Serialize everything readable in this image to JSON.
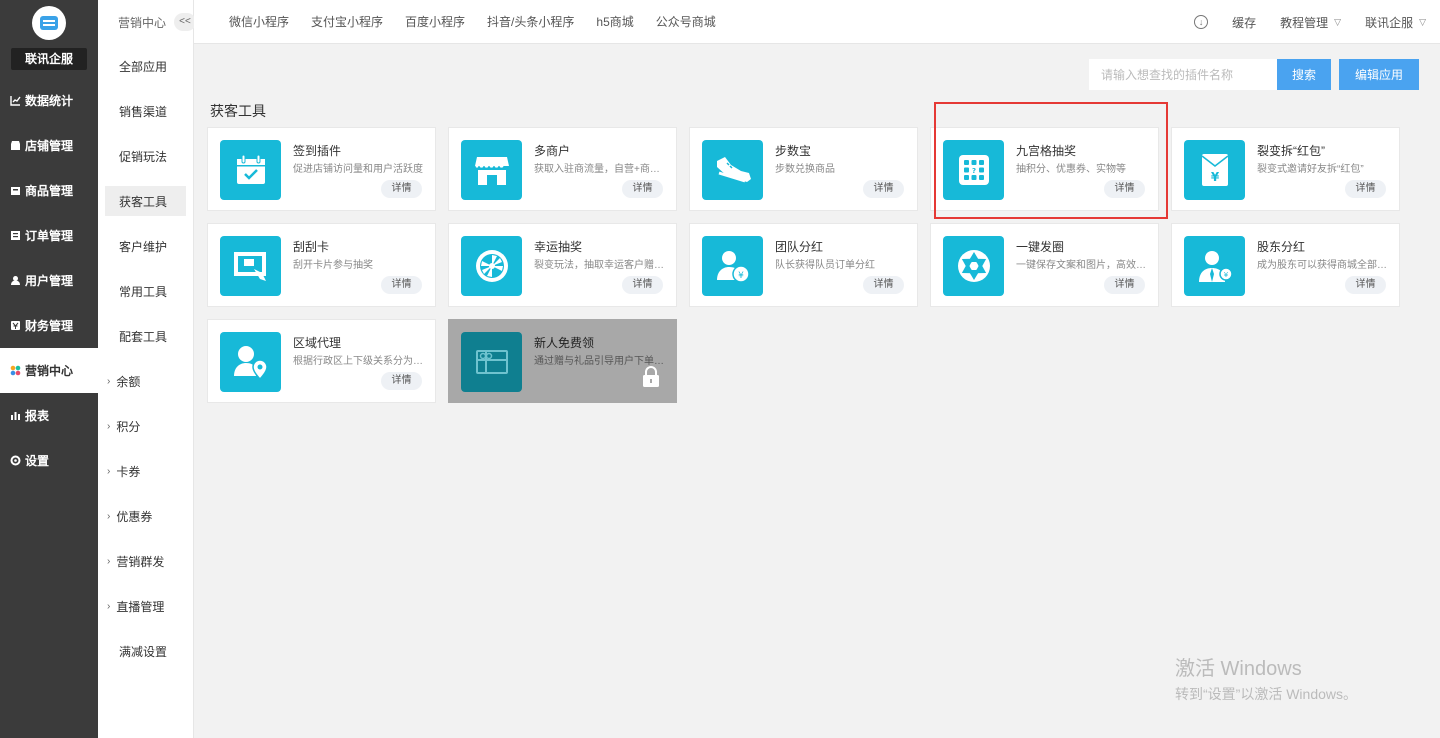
{
  "brand": {
    "name": "联讯企服"
  },
  "sidebar": {
    "items": [
      {
        "label": "数据统计",
        "icon": "chart-line-icon",
        "active": false
      },
      {
        "label": "店铺管理",
        "icon": "shop-icon",
        "active": false
      },
      {
        "label": "商品管理",
        "icon": "goods-icon",
        "active": false
      },
      {
        "label": "订单管理",
        "icon": "order-icon",
        "active": false
      },
      {
        "label": "用户管理",
        "icon": "user-icon",
        "active": false
      },
      {
        "label": "财务管理",
        "icon": "finance-icon",
        "active": false
      },
      {
        "label": "营销中心",
        "icon": "marketing-icon",
        "active": true
      },
      {
        "label": "报表",
        "icon": "report-icon",
        "active": false
      },
      {
        "label": "设置",
        "icon": "settings-icon",
        "active": false
      }
    ]
  },
  "submenu": {
    "title": "营销中心",
    "collapse_label": "<<",
    "items": [
      {
        "label": "全部应用"
      },
      {
        "label": "销售渠道"
      },
      {
        "label": "促销玩法"
      },
      {
        "label": "获客工具",
        "active": true
      },
      {
        "label": "客户维护"
      },
      {
        "label": "常用工具"
      },
      {
        "label": "配套工具"
      }
    ],
    "groups": [
      "余额",
      "积分",
      "卡券",
      "优惠券",
      "营销群发",
      "直播管理"
    ],
    "last_item": "满减设置"
  },
  "topbar": {
    "tabs": [
      "微信小程序",
      "支付宝小程序",
      "百度小程序",
      "抖音/头条小程序",
      "h5商城",
      "公众号商城"
    ],
    "cache_label": "缓存",
    "tutorial_label": "教程管理",
    "account_label": "联讯企服"
  },
  "search": {
    "placeholder": "请输入想查找的插件名称",
    "search_label": "搜索",
    "edit_label": "编辑应用"
  },
  "section_title": "获客工具",
  "cards": [
    {
      "name": "签到插件",
      "desc": "促进店铺访问量和用户活跃度",
      "detail": "详情",
      "icon": "calendar-check-icon"
    },
    {
      "name": "多商户",
      "desc": "获取入驻商流量，自营+商户入驻",
      "detail": "详情",
      "icon": "store-icon"
    },
    {
      "name": "步数宝",
      "desc": "步数兑换商品",
      "detail": "详情",
      "icon": "sneaker-icon"
    },
    {
      "name": "九宫格抽奖",
      "desc": "抽积分、优惠券、实物等",
      "detail": "详情",
      "icon": "grid-lottery-icon"
    },
    {
      "name": "裂变拆“红包”",
      "desc": "裂变式邀请好友拆“红包”",
      "detail": "详情",
      "icon": "red-envelope-icon"
    },
    {
      "name": "刮刮卡",
      "desc": "刮开卡片参与抽奖",
      "detail": "详情",
      "icon": "scratch-card-icon"
    },
    {
      "name": "幸运抽奖",
      "desc": "裂变玩法，抽取幸运客户赠送奖品",
      "detail": "详情",
      "icon": "wheel-icon"
    },
    {
      "name": "团队分红",
      "desc": "队长获得队员订单分红",
      "detail": "详情",
      "icon": "team-dividend-icon"
    },
    {
      "name": "一键发圈",
      "desc": "一键保存文案和图片，高效发圈",
      "detail": "详情",
      "icon": "aperture-icon"
    },
    {
      "name": "股东分红",
      "desc": "成为股东可以获得商城全部自营订单分红",
      "detail": "详情",
      "icon": "shareholder-icon"
    },
    {
      "name": "区域代理",
      "desc": "根据行政区上下级关系分为省市区代理",
      "detail": "详情",
      "icon": "region-agent-icon"
    },
    {
      "name": "新人免费领",
      "desc": "通过赠与礼品引导用户下单，提高转化",
      "detail": "",
      "icon": "gift-icon",
      "locked": true
    }
  ],
  "watermark": {
    "line1": "激活 Windows",
    "line2": "转到“设置”以激活 Windows。"
  },
  "colors": {
    "sidebar_bg": "#3b3b3b",
    "accent": "#4aa3f0",
    "card_icon": "#17b9d8",
    "highlight": "#e53935"
  }
}
